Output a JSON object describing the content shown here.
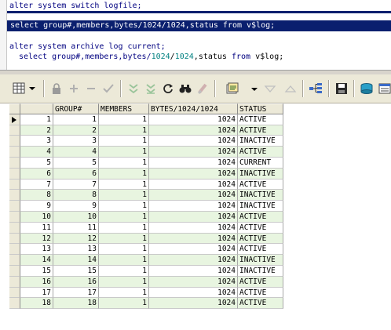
{
  "editor": {
    "line1": "alter system switch logfile;",
    "selected_sql": "select group#,members,bytes/1024/1024,status from v$log;",
    "line3": "alter system archive log current;",
    "line4_a": "select group#,members,bytes/",
    "line4_n1": "1024",
    "line4_s": "/",
    "line4_n2": "1024",
    "line4_b": ",status",
    "line4_from": "from",
    "line4_c": "v$log;"
  },
  "toolbar": {
    "icons": [
      "grid-menu-icon",
      "lock-icon",
      "add-icon",
      "remove-icon",
      "post-icon",
      "sort-down-icon",
      "sort-clear-icon",
      "refresh-icon",
      "find-icon",
      "clear-icon",
      "export-icon",
      "filter-down-icon",
      "filter-up-icon",
      "tree-icon",
      "save-icon",
      "query-icon",
      "view-icon"
    ]
  },
  "grid": {
    "columns": [
      "GROUP#",
      "MEMBERS",
      "BYTES/1024/1024",
      "STATUS"
    ],
    "rows": [
      {
        "n": "1",
        "group": "1",
        "members": "1",
        "mb": "1024",
        "status": "ACTIVE"
      },
      {
        "n": "2",
        "group": "2",
        "members": "1",
        "mb": "1024",
        "status": "ACTIVE"
      },
      {
        "n": "3",
        "group": "3",
        "members": "1",
        "mb": "1024",
        "status": "INACTIVE"
      },
      {
        "n": "4",
        "group": "4",
        "members": "1",
        "mb": "1024",
        "status": "ACTIVE"
      },
      {
        "n": "5",
        "group": "5",
        "members": "1",
        "mb": "1024",
        "status": "CURRENT"
      },
      {
        "n": "6",
        "group": "6",
        "members": "1",
        "mb": "1024",
        "status": "INACTIVE"
      },
      {
        "n": "7",
        "group": "7",
        "members": "1",
        "mb": "1024",
        "status": "ACTIVE"
      },
      {
        "n": "8",
        "group": "8",
        "members": "1",
        "mb": "1024",
        "status": "INACTIVE"
      },
      {
        "n": "9",
        "group": "9",
        "members": "1",
        "mb": "1024",
        "status": "INACTIVE"
      },
      {
        "n": "10",
        "group": "10",
        "members": "1",
        "mb": "1024",
        "status": "ACTIVE"
      },
      {
        "n": "11",
        "group": "11",
        "members": "1",
        "mb": "1024",
        "status": "ACTIVE"
      },
      {
        "n": "12",
        "group": "12",
        "members": "1",
        "mb": "1024",
        "status": "ACTIVE"
      },
      {
        "n": "13",
        "group": "13",
        "members": "1",
        "mb": "1024",
        "status": "ACTIVE"
      },
      {
        "n": "14",
        "group": "14",
        "members": "1",
        "mb": "1024",
        "status": "INACTIVE"
      },
      {
        "n": "15",
        "group": "15",
        "members": "1",
        "mb": "1024",
        "status": "INACTIVE"
      },
      {
        "n": "16",
        "group": "16",
        "members": "1",
        "mb": "1024",
        "status": "ACTIVE"
      },
      {
        "n": "17",
        "group": "17",
        "members": "1",
        "mb": "1024",
        "status": "ACTIVE"
      },
      {
        "n": "18",
        "group": "18",
        "members": "1",
        "mb": "1024",
        "status": "ACTIVE"
      }
    ]
  },
  "colors": {
    "selection": "#0a1f6e",
    "row_alt": "#e8f5e0",
    "toolbar_bg": "#ece9d8"
  }
}
